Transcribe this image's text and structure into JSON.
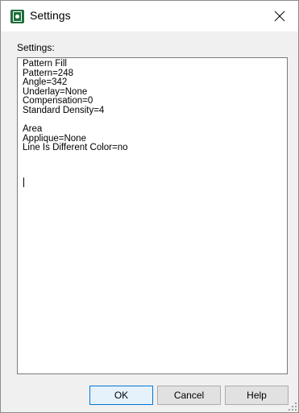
{
  "window": {
    "title": "Settings"
  },
  "dialog": {
    "settings_label": "Settings:",
    "settings_text": "Pattern Fill\nPattern=248\nAngle=342\nUnderlay=None\nCompensation=0\nStandard Density=4\n\nArea\nApplique=None\nLine Is Different Color=no"
  },
  "buttons": {
    "ok_label": "OK",
    "cancel_label": "Cancel",
    "help_label": "Help"
  },
  "icons": {
    "app": "settings-app-icon",
    "close": "close-icon"
  },
  "colors": {
    "accent": "#0078d7",
    "app_icon": "#1e6e3c"
  }
}
